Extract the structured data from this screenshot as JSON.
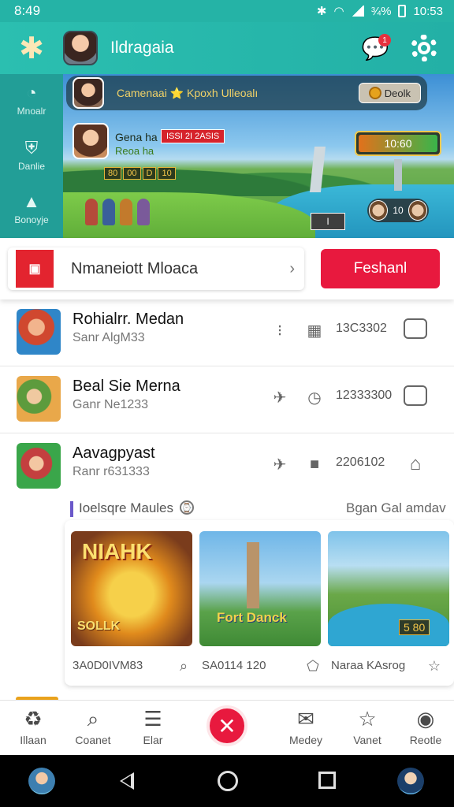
{
  "status_bar": {
    "time": "8:49",
    "network": "¾%",
    "clock": "10:53"
  },
  "app_bar": {
    "title": "Ildragaia",
    "notification_count": "1"
  },
  "side_rail": [
    {
      "icon": "chat-icon",
      "label": "Mnoalr"
    },
    {
      "icon": "shield-icon",
      "label": "Danlie"
    },
    {
      "icon": "tent-icon",
      "label": "Bonoyje"
    }
  ],
  "banner": {
    "strip_text": "Camenaai ⭐ Kpoxh Ulleoalı",
    "strip_button": "Deolk",
    "player_name": "Gena ha",
    "player_tag": "ISSI 2I 2ASIS",
    "player_sub": "Reoa ha",
    "stats": [
      "80",
      "00",
      "D",
      "10"
    ],
    "timer": "10:60",
    "slot_value": "I",
    "hero_count": "10"
  },
  "search": {
    "text": "Nmaneiott Mloaca",
    "button": "Feshanl"
  },
  "games": [
    {
      "title": "Rohialrr. Medan",
      "sub": "Sanr AlgM33",
      "num": "13C3302",
      "a_icon": "grip-icon",
      "b_icon": "bag-icon",
      "end_icon": "chat-bubble-icon"
    },
    {
      "title": "Beal Sie Merna",
      "sub": "Ganr Ne1233",
      "num": "12333300",
      "a_icon": "rocket-icon",
      "b_icon": "timer-icon",
      "end_icon": "message-icon"
    },
    {
      "title": "Aavagpyast",
      "sub": "Ranr r631333",
      "num": "2206102",
      "a_icon": "rocket-icon",
      "b_icon": "square-icon",
      "end_icon": "home-icon"
    }
  ],
  "reco": {
    "title": "Ioelsqre Maules",
    "link": "Bgan Gal amdav",
    "tiles": [
      {
        "title": "NIAHK",
        "sub": "SOLLK",
        "label": "3A0D0IVM83",
        "icon": "search-icon"
      },
      {
        "title": "Fort Danck",
        "label": "SA0114 120",
        "icon": "tag-icon"
      },
      {
        "title": "5 80",
        "label": "Naraa KAsrog",
        "icon": "star-icon"
      }
    ]
  },
  "bottom_nav": [
    {
      "label": "Illaan",
      "icon": "recycle-icon"
    },
    {
      "label": "Coanet",
      "icon": "search-icon"
    },
    {
      "label": "Elar",
      "icon": "menu-icon"
    },
    {
      "label": "Medey",
      "icon": "inbox-icon"
    },
    {
      "label": "Vanet",
      "icon": "star-icon"
    },
    {
      "label": "Reotle",
      "icon": "profile-icon"
    }
  ],
  "colors": {
    "teal": "#25b3a6",
    "red": "#e8193e",
    "purple_accent": "#6a58c9"
  }
}
